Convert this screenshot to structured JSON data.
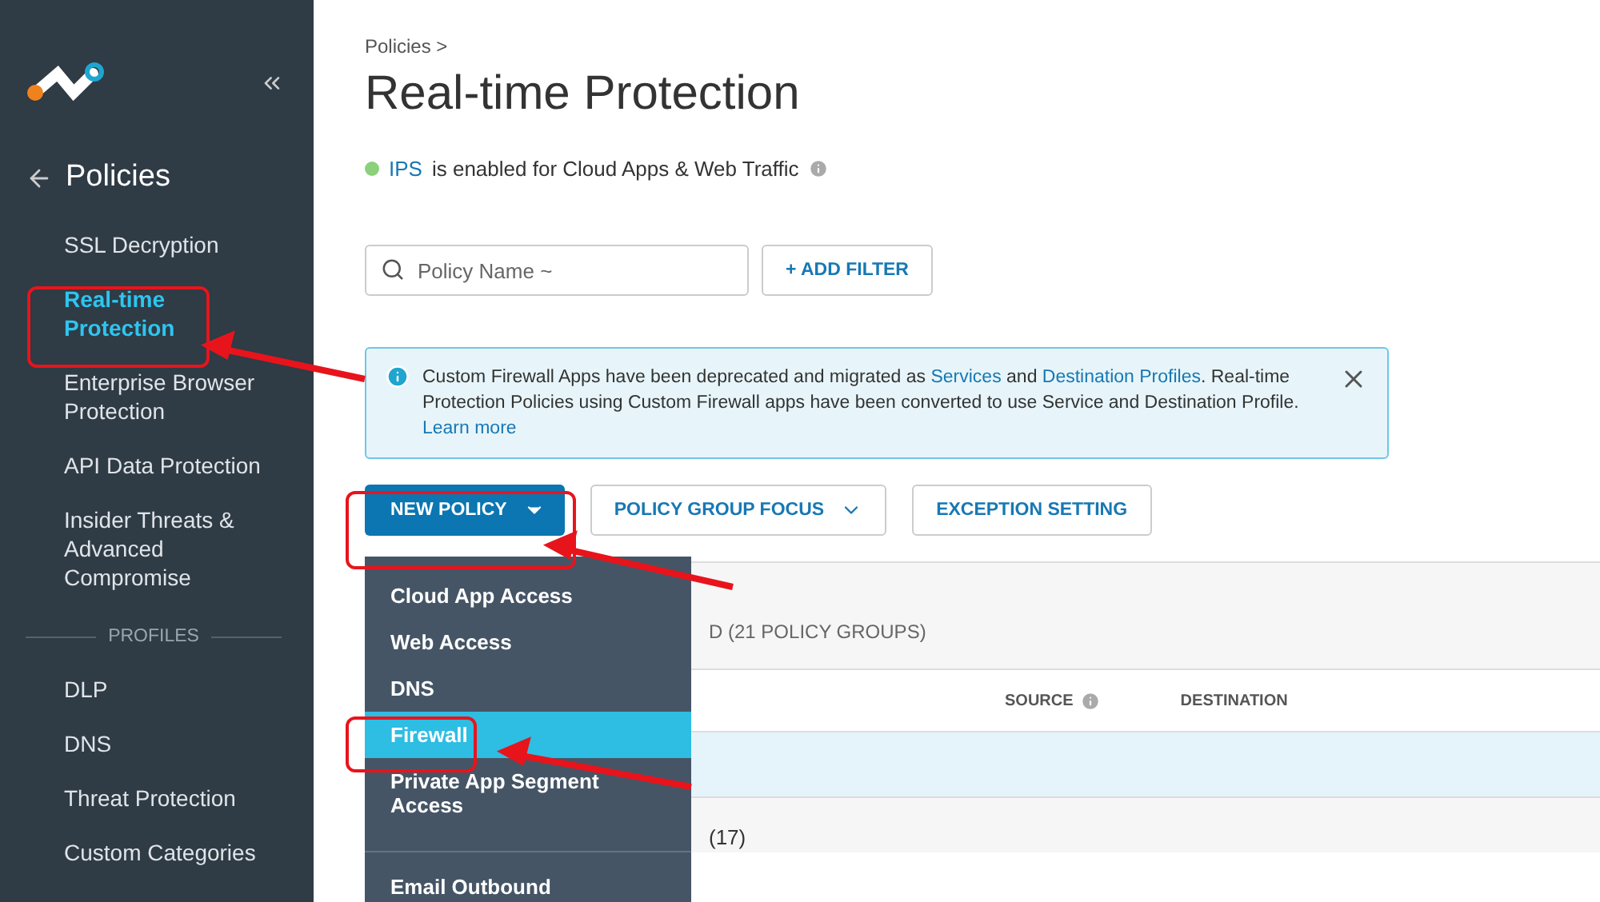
{
  "sidebar": {
    "back_title": "Policies",
    "nav": [
      {
        "label": "SSL Decryption",
        "selected": false
      },
      {
        "label": "Real-time Protection",
        "selected": true
      },
      {
        "label": "Enterprise Browser Protection",
        "selected": false
      },
      {
        "label": "API Data Protection",
        "selected": false
      },
      {
        "label": "Insider Threats & Advanced Compromise",
        "selected": false
      }
    ],
    "section": "PROFILES",
    "profiles": [
      {
        "label": "DLP",
        "selected": false
      },
      {
        "label": "DNS",
        "selected": false
      },
      {
        "label": "Threat Protection",
        "selected": false
      },
      {
        "label": "Custom Categories",
        "selected": false
      }
    ]
  },
  "breadcrumb": "Policies >",
  "title": "Real-time Protection",
  "status": {
    "color": "#8bd07a",
    "link": "IPS",
    "text": "is enabled for Cloud Apps & Web Traffic"
  },
  "search": {
    "placeholder": "Policy Name ~"
  },
  "add_filter": "+ ADD FILTER",
  "banner": {
    "parts": [
      "Custom Firewall Apps have been deprecated and migrated as ",
      "Services",
      " and ",
      "Destination Profiles",
      ". Real-time Protection Policies using Custom Firewall apps have been converted to use Service and Destination Profile. "
    ],
    "learn_more": "Learn more"
  },
  "actions": [
    {
      "label": "NEW POLICY",
      "kind": "primary"
    },
    {
      "label": "POLICY GROUP FOCUS",
      "kind": "dropdown"
    },
    {
      "label": "EXCEPTION SETTING",
      "kind": "plain"
    }
  ],
  "menu": [
    {
      "label": "Cloud App Access",
      "selected": false
    },
    {
      "label": "Web Access",
      "selected": false
    },
    {
      "label": "DNS",
      "selected": false
    },
    {
      "label": "Firewall",
      "selected": true
    },
    {
      "label": "Private App Segment Access",
      "selected": false
    },
    {
      "label": "Email Outbound",
      "selected": false,
      "divider": true
    }
  ],
  "table": {
    "summary": "D (21 POLICY GROUPS)",
    "columns": [
      "SOURCE",
      "DESTINATION"
    ],
    "group_row": "(17)"
  }
}
